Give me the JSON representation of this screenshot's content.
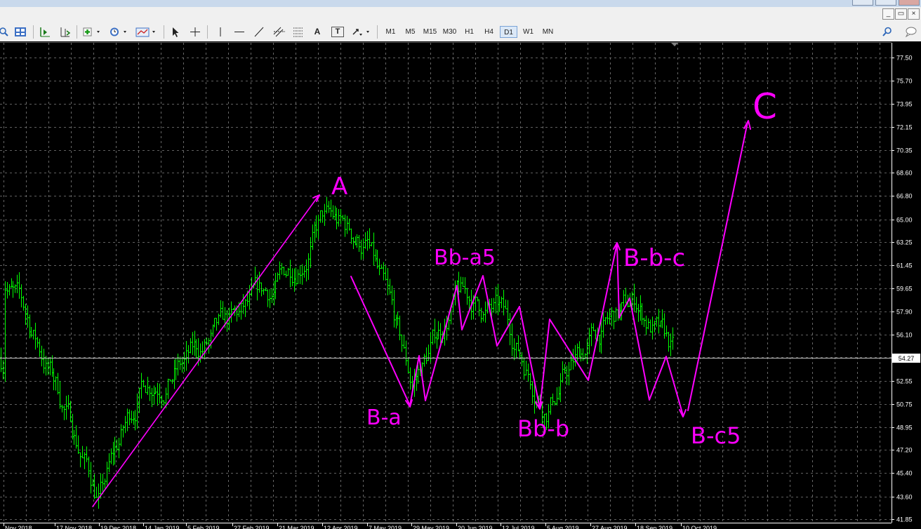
{
  "toolbar": {
    "timeframes": [
      "M1",
      "M5",
      "M15",
      "M30",
      "H1",
      "H4",
      "D1",
      "W1",
      "MN"
    ],
    "active_timeframe": "D1",
    "text_tool": "A",
    "label_tool": "T"
  },
  "window_controls": {
    "minimize": "_",
    "restore": "▭",
    "close": "×"
  },
  "colors": {
    "background": "#000000",
    "grid": "#808080",
    "candle": "#00ff00",
    "annotation": "#ff00ff",
    "price_line": "#c0c0c0"
  },
  "chart_data": {
    "type": "line",
    "style": "ohlc bars, daily",
    "ylim": [
      41.85,
      78.6
    ],
    "y_ticks": [
      "77.50",
      "75.70",
      "73.95",
      "72.15",
      "70.35",
      "68.60",
      "66.80",
      "65.00",
      "63.25",
      "61.45",
      "59.65",
      "57.90",
      "56.10",
      "54.35",
      "52.55",
      "50.75",
      "48.95",
      "47.20",
      "45.40",
      "43.60",
      "41.85"
    ],
    "current_price": "54.27",
    "x_ticks": [
      "Nov 2018",
      "17 Nov 2018",
      "19 Dec 2018",
      "14 Jan 2019",
      "5 Feb 2019",
      "27 Feb 2019",
      "21 Mar 2019",
      "12 Apr 2019",
      "7 May 2019",
      "29 May 2019",
      "20 Jun 2019",
      "12 Jul 2019",
      "5 Aug 2019",
      "27 Aug 2019",
      "18 Sep 2019",
      "10 Oct 2019"
    ],
    "grid": true,
    "series": [
      {
        "x": [
          "Nov 2018",
          "17 Nov 2018",
          "19 Dec 2018",
          "14 Jan 2019",
          "5 Feb 2019",
          "27 Feb 2019",
          "21 Mar 2019",
          "12 Apr 2019",
          "7 May 2019",
          "29 May 2019",
          "20 Jun 2019",
          "12 Jul 2019",
          "5 Aug 2019",
          "27 Aug 2019",
          "18 Sep 2019",
          "10 Oct 2019"
        ],
        "values": [
          61.0,
          52.5,
          43.5,
          52.5,
          54.0,
          56.5,
          59.5,
          65.0,
          63.0,
          52.0,
          59.0,
          57.5,
          51.0,
          55.5,
          58.5,
          53.5
        ]
      }
    ],
    "annotations": [
      "A",
      "B-a",
      "Bb-a5",
      "Bb-b",
      "B-b-c",
      "B-c5",
      "C"
    ]
  }
}
